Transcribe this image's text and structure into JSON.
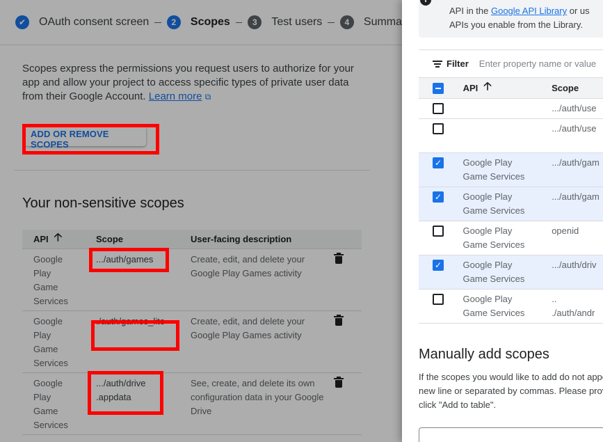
{
  "stepper": {
    "steps": [
      {
        "num": "✔",
        "label": "OAuth consent screen"
      },
      {
        "num": "2",
        "label": "Scopes"
      },
      {
        "num": "3",
        "label": "Test users"
      },
      {
        "num": "4",
        "label": "Summa"
      }
    ]
  },
  "intro": {
    "text": "Scopes express the permissions you request users to authorize for your app and allow your project to access specific types of private user data from their Google Account.",
    "link": "Learn more",
    "link_icon": "⧉"
  },
  "add_button": "ADD OR REMOVE SCOPES",
  "non_sensitive": {
    "title": "Your non-sensitive scopes",
    "headers": {
      "api": "API",
      "api_sort": "🡡",
      "scope": "Scope",
      "desc": "User-facing description"
    },
    "rows": [
      {
        "api": "Google Play Game Services",
        "scope": ".../auth/games",
        "desc": "Create, edit, and delete your Google Play Games activity"
      },
      {
        "api": "Google Play Game Services",
        "scope": "./auth/games_lite",
        "desc": "Create, edit, and delete your Google Play Games activity"
      },
      {
        "api": "Google Play Game Services",
        "scope": ".../auth/drive .appdata",
        "desc": "See, create, and delete its own configuration data in your Google Drive"
      }
    ]
  },
  "panel": {
    "info": {
      "icon": "i",
      "line1": "API in the ",
      "link": "Google API Library",
      "line1_end": " or us",
      "line2": "APIs you enable from the Library."
    },
    "filter": {
      "label": "Filter",
      "placeholder": "Enter property name or value"
    },
    "headers": {
      "api": "API",
      "api_sort": "🡡",
      "scope": "Scope"
    },
    "rows": [
      {
        "checked": false,
        "api": "",
        "scope": ".../auth/use",
        "height": 29
      },
      {
        "checked": false,
        "api": "",
        "scope": ".../auth/use",
        "height": 49
      },
      {
        "checked": true,
        "api": "Google Play Game Services",
        "scope": ".../auth/gam",
        "height": 49
      },
      {
        "checked": true,
        "api": "Google Play Game Services",
        "scope": ".../auth/gam",
        "height": 49
      },
      {
        "checked": false,
        "api": "Google Play Game Services",
        "scope": "openid",
        "height": 49
      },
      {
        "checked": true,
        "api": "Google Play Game Services",
        "scope": ".../auth/driv",
        "height": 49
      },
      {
        "checked": false,
        "api": "Google Play Game Services",
        "scope": "..\n./auth/andr",
        "height": 49
      }
    ],
    "manual": {
      "title": "Manually add scopes",
      "line1": "If the scopes you would like to add do not appe",
      "line2": "new line or separated by commas. Please provi",
      "line3": "click \"Add to table\"."
    }
  },
  "colors": {
    "accent": "#1a73e8",
    "highlight": "#ff0000"
  }
}
